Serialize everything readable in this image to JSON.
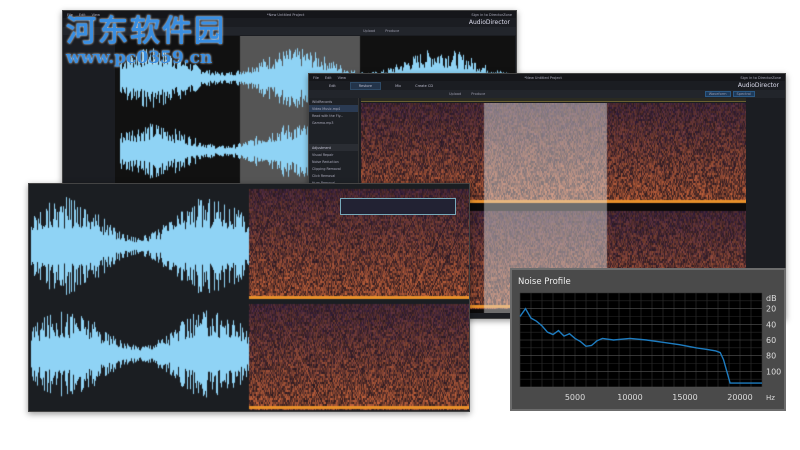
{
  "watermark": {
    "title": "河东软件园",
    "url": "www.pc0359.cn"
  },
  "app": {
    "menu": [
      "File",
      "Edit",
      "View"
    ],
    "window_title": "*New Untitled Project",
    "sign_in": "Sign in to DirectorZone",
    "brand": "AudioDirector",
    "tabs": [
      "Edit",
      "Restore",
      "Mix",
      "Create CD"
    ],
    "active_tab": "Restore",
    "toolbar": {
      "upload": "Upload",
      "produce": "Produce",
      "view_modes": [
        "Waveform",
        "Spectral"
      ]
    },
    "library": [
      "WildRecords",
      "Video Music.mp4",
      "Read with the Fly...",
      "Gamma.mp3"
    ],
    "adjustment": {
      "header": "Adjustment",
      "items": [
        "Visual Repair",
        "Noise Reduction",
        "Clipping Removal",
        "Click Removal",
        "Hum Removal"
      ]
    }
  },
  "colors": {
    "accent": "#2b7fd4",
    "waveform": "#8fd3f5",
    "spectrogram": "#c86a28",
    "curve": "#1e7cc0"
  },
  "noise_profile": {
    "title": "Noise Profile"
  },
  "chart_data": {
    "type": "line",
    "title": "Noise Profile",
    "xlabel": "Hz",
    "ylabel": "dB",
    "xlim": [
      0,
      22000
    ],
    "ylim": [
      0,
      120
    ],
    "y_inverted": true,
    "grid": true,
    "xticks": [
      "5000",
      "10000",
      "15000",
      "20000"
    ],
    "yticks": [
      "20",
      "40",
      "60",
      "80",
      "100"
    ],
    "x": [
      0,
      500,
      1000,
      1500,
      2000,
      2500,
      3000,
      3500,
      4000,
      4500,
      5000,
      5500,
      6000,
      6500,
      7000,
      7500,
      8500,
      10000,
      11500,
      13000,
      14500,
      16000,
      17000,
      17800,
      18200,
      18500,
      18800,
      19100,
      20000,
      21000,
      22000
    ],
    "y": [
      30,
      20,
      32,
      36,
      42,
      50,
      53,
      48,
      55,
      52,
      58,
      62,
      68,
      67,
      61,
      58,
      60,
      58,
      60,
      63,
      66,
      70,
      72,
      74,
      76,
      85,
      100,
      115,
      115,
      115,
      115
    ]
  }
}
